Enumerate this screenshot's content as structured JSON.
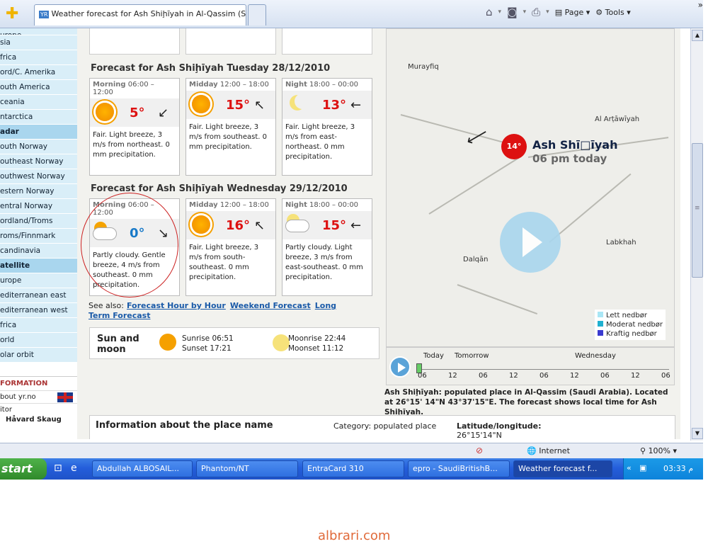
{
  "browser": {
    "tab_title": "Weather forecast for Ash Shiḩīyah in Al-Qassim (Saud...",
    "tab_badge": "YR",
    "tools": {
      "page": "Page",
      "tools": "Tools"
    }
  },
  "nav": {
    "items": [
      {
        "label": "urope",
        "hdr": false
      },
      {
        "label": "sia",
        "hdr": false
      },
      {
        "label": "frica",
        "hdr": false
      },
      {
        "label": "ord/C. Amerika",
        "hdr": false
      },
      {
        "label": "outh America",
        "hdr": false
      },
      {
        "label": "ceania",
        "hdr": false
      },
      {
        "label": "ntarctica",
        "hdr": false
      },
      {
        "label": "adar",
        "hdr": true
      },
      {
        "label": "outh Norway",
        "hdr": false
      },
      {
        "label": "outheast Norway",
        "hdr": false
      },
      {
        "label": "outhwest Norway",
        "hdr": false
      },
      {
        "label": "estern Norway",
        "hdr": false
      },
      {
        "label": "entral Norway",
        "hdr": false
      },
      {
        "label": "ordland/Troms",
        "hdr": false
      },
      {
        "label": "roms/Finnmark",
        "hdr": false
      },
      {
        "label": "candinavia",
        "hdr": false
      },
      {
        "label": "atellite",
        "hdr": true
      },
      {
        "label": "urope",
        "hdr": false
      },
      {
        "label": "editerranean east",
        "hdr": false
      },
      {
        "label": "editerranean west",
        "hdr": false
      },
      {
        "label": "frica",
        "hdr": false
      },
      {
        "label": "orld",
        "hdr": false
      },
      {
        "label": "olar orbit",
        "hdr": false
      }
    ],
    "info_title": "FORMATION",
    "about": "bout yr.no",
    "editor_label": "itor",
    "editor_name": "Håvard Skaug"
  },
  "forecast1": {
    "heading": "Forecast for Ash Shiḩīyah Tuesday 28/12/2010",
    "cards": [
      {
        "period": "Morning",
        "time": "06:00 – 12:00",
        "temp": "5°",
        "arrow": "↙",
        "desc": "Fair. Light breeze, 3 m/s from northeast. 0 mm precipitation.",
        "icon": "sun-icon"
      },
      {
        "period": "Midday",
        "time": "12:00 – 18:00",
        "temp": "15°",
        "arrow": "↖",
        "desc": "Fair. Light breeze, 3 m/s from southeast. 0 mm precipitation.",
        "icon": "sun-icon"
      },
      {
        "period": "Night",
        "time": "18:00 – 00:00",
        "temp": "13°",
        "arrow": "←",
        "desc": "Fair. Light breeze, 3 m/s from east-northeast. 0 mm precipitation.",
        "icon": "moon-icon"
      }
    ]
  },
  "forecast2": {
    "heading": "Forecast for Ash Shiḩīyah Wednesday 29/12/2010",
    "cards": [
      {
        "period": "Morning",
        "time": "06:00 – 12:00",
        "temp": "0°",
        "arrow": "↘",
        "desc": "Partly cloudy. Gentle breeze, 4 m/s from southeast. 0 mm precipitation.",
        "icon": "partly-cloudy-icon"
      },
      {
        "period": "Midday",
        "time": "12:00 – 18:00",
        "temp": "16°",
        "arrow": "↖",
        "desc": "Fair. Light breeze, 3 m/s from south-southeast. 0 mm precipitation.",
        "icon": "sun-icon"
      },
      {
        "period": "Night",
        "time": "18:00 – 00:00",
        "temp": "15°",
        "arrow": "←",
        "desc": "Partly cloudy. Light breeze, 3 m/s from east-southeast. 0 mm precipitation.",
        "icon": "partly-cloudy-night-icon"
      }
    ]
  },
  "see_also": {
    "label": "See also:",
    "links": [
      "Forecast Hour by Hour",
      "Weekend Forecast",
      "Long Term Forecast"
    ]
  },
  "sun_moon": {
    "title_line1": "Sun and",
    "title_line2": "moon",
    "sunrise": "Sunrise 06:51",
    "sunset": "Sunset 17:21",
    "moonrise": "Moonrise 22:44",
    "moonset": "Moonset 11:12"
  },
  "map": {
    "places": [
      "Murayfiq",
      "Al Arṭāwīyah",
      "Dalqān",
      "Labkhah"
    ],
    "temp_badge": "14°",
    "name": "Ash Shī□īyah",
    "time": "06 pm today",
    "legend": [
      "Lett nedbør",
      "Moderat nedbør",
      "Kraftig nedbør"
    ],
    "legend_colors": [
      "#a9e6f5",
      "#1fb0d0",
      "#3a3ad0"
    ]
  },
  "timeline": {
    "today": "Today",
    "tomorrow": "Tomorrow",
    "wednesday": "Wednesday",
    "ticks": [
      "06",
      "12",
      "06",
      "12",
      "06",
      "12",
      "06",
      "12",
      "06"
    ]
  },
  "caption": "Ash Shiḩīyah: populated place in Al-Qassim (Saudi Arabia). Located at 26°15' 14\"N 43°37'15\"E. The forecast shows local time for Ash Shiḩīyah.",
  "place_info": {
    "title": "Information about the place name",
    "category_label": "Category:",
    "category": "populated place",
    "latlon_label": "Latitude/longitude:",
    "latlon": "26°15'14\"N"
  },
  "status": {
    "zone": "Internet",
    "zoom": "100%"
  },
  "taskbar": {
    "start": "start",
    "tasks": [
      "Abdullah ALBOSAIL...",
      "Phantom/NT",
      "EntraCard 310",
      "epro - SaudiBritishB...",
      "Weather forecast f..."
    ],
    "clock": "03:33 م"
  },
  "watermark": "albrari.com"
}
